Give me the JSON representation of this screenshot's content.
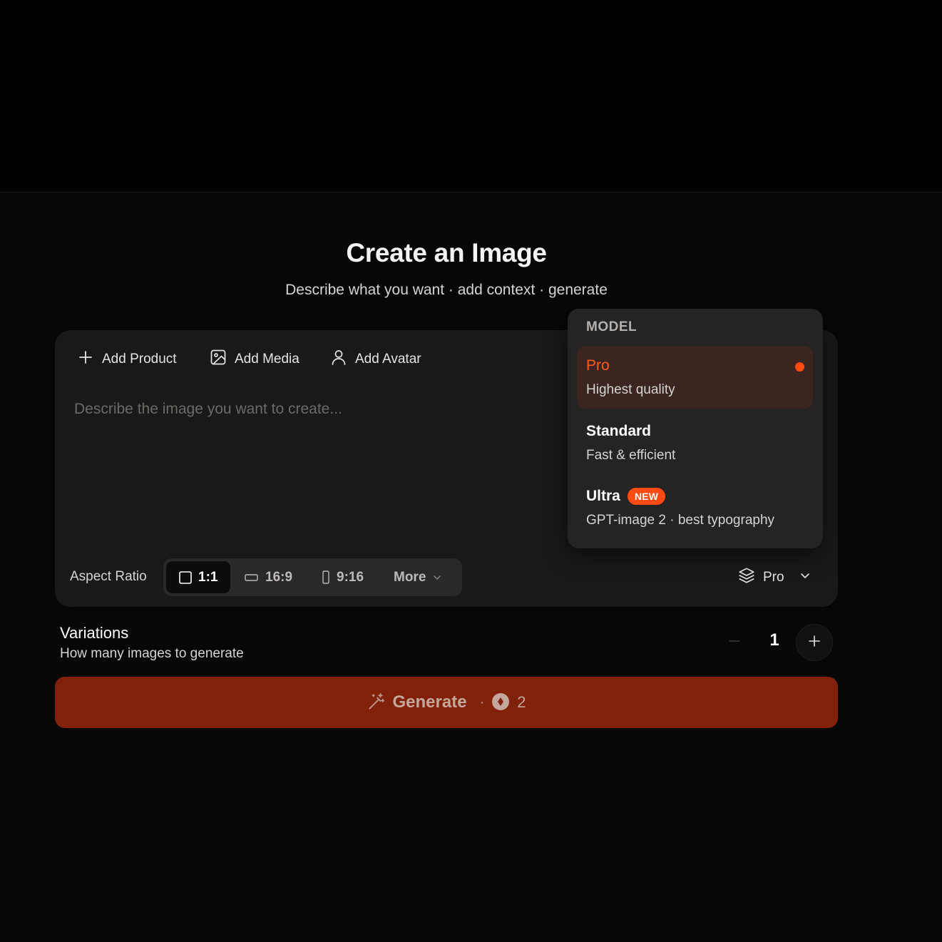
{
  "header": {
    "title": "Create an Image",
    "subtitle": "Describe what you want · add context · generate"
  },
  "context_buttons": {
    "add_product": "Add Product",
    "add_media": "Add Media",
    "add_avatar": "Add Avatar"
  },
  "prompt": {
    "placeholder": "Describe the image you want to create...",
    "value": ""
  },
  "aspect_ratio": {
    "label": "Aspect Ratio",
    "options": [
      {
        "label": "1:1",
        "selected": true
      },
      {
        "label": "16:9",
        "selected": false
      },
      {
        "label": "9:16",
        "selected": false
      }
    ],
    "more_label": "More"
  },
  "model_selector": {
    "current": "Pro"
  },
  "model_dropdown": {
    "header": "MODEL",
    "items": [
      {
        "name": "Pro",
        "description": "Highest quality",
        "selected": true
      },
      {
        "name": "Standard",
        "description": "Fast & efficient",
        "selected": false
      },
      {
        "name": "Ultra",
        "badge": "NEW",
        "description": "GPT-image 2 · best typography",
        "selected": false
      }
    ]
  },
  "variations": {
    "title": "Variations",
    "subtitle": "How many images to generate",
    "value": "1"
  },
  "generate": {
    "label": "Generate",
    "separator": "·",
    "cost": "2"
  },
  "colors": {
    "accent": "#ff4a12",
    "generate_bg": "#82210a",
    "card_bg": "#1a1818",
    "page_bg": "#080707"
  }
}
